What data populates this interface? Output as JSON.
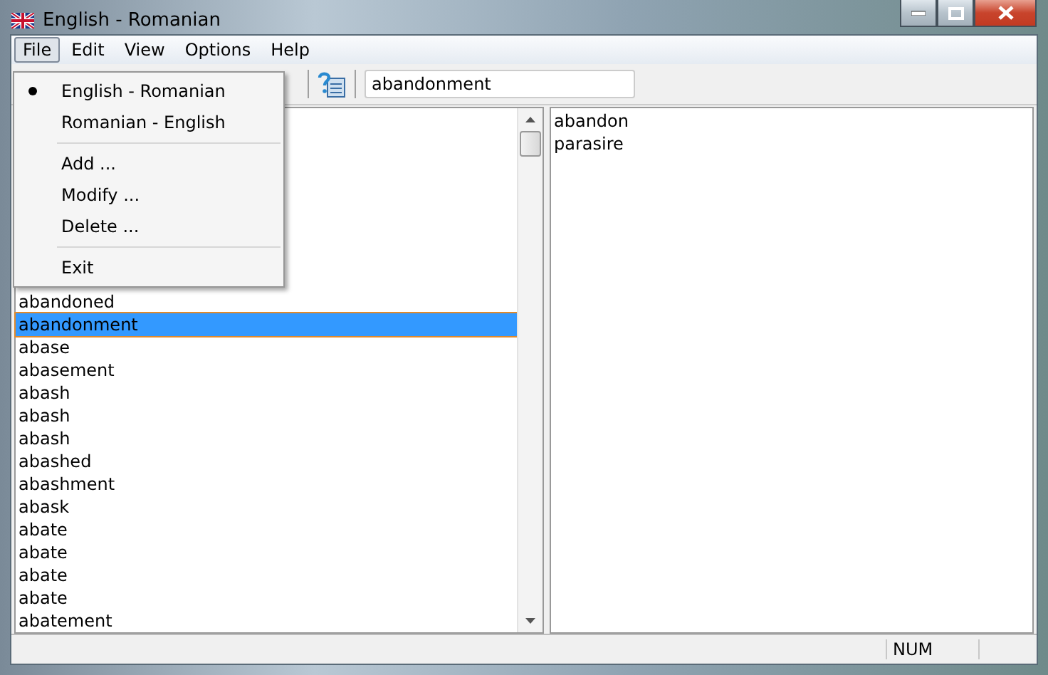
{
  "window": {
    "title": "English - Romanian"
  },
  "menu_bar": [
    {
      "label": "File",
      "selected": true
    },
    {
      "label": "Edit",
      "selected": false
    },
    {
      "label": "View",
      "selected": false
    },
    {
      "label": "Options",
      "selected": false
    },
    {
      "label": "Help",
      "selected": false
    }
  ],
  "file_menu": [
    {
      "kind": "item",
      "label": "English - Romanian",
      "selected": true
    },
    {
      "kind": "item",
      "label": "Romanian - English",
      "selected": false
    },
    {
      "kind": "separator"
    },
    {
      "kind": "item",
      "label": "Add ...",
      "selected": false
    },
    {
      "kind": "item",
      "label": "Modify ...",
      "selected": false
    },
    {
      "kind": "item",
      "label": "Delete ...",
      "selected": false
    },
    {
      "kind": "separator"
    },
    {
      "kind": "item",
      "label": "Exit",
      "selected": false
    }
  ],
  "search": {
    "value": "abandonment"
  },
  "word_list": [
    {
      "word": "abandoned",
      "selected": false
    },
    {
      "word": "abandonment",
      "selected": true
    },
    {
      "word": "abase",
      "selected": false
    },
    {
      "word": "abasement",
      "selected": false
    },
    {
      "word": "abash",
      "selected": false
    },
    {
      "word": "abash",
      "selected": false
    },
    {
      "word": "abash",
      "selected": false
    },
    {
      "word": "abashed",
      "selected": false
    },
    {
      "word": "abashment",
      "selected": false
    },
    {
      "word": "abask",
      "selected": false
    },
    {
      "word": "abate",
      "selected": false
    },
    {
      "word": "abate",
      "selected": false
    },
    {
      "word": "abate",
      "selected": false
    },
    {
      "word": "abate",
      "selected": false
    },
    {
      "word": "abatement",
      "selected": false
    }
  ],
  "translations": [
    "abandon",
    "parasire"
  ],
  "status_bar": {
    "num": "NUM"
  }
}
